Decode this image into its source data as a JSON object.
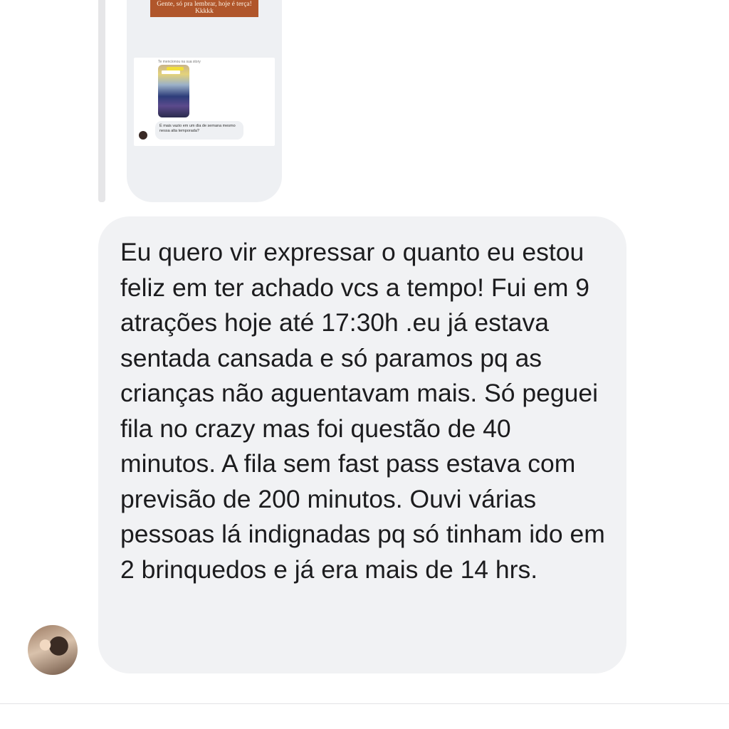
{
  "story_reply": {
    "banner_text": "Gente, só pra lembrar, hoje é terça! Kkkkk",
    "shot_caption": "Te mencionou na sua story",
    "shot_reply_text": "É mais vazio em um dia de semana mesmo nessa alta temporada?"
  },
  "message": {
    "segments": [
      "Eu quero",
      " vir expressar o quanto eu",
      " estou fe",
      "liz em ter achado vcs a tempo! Fui em ",
      "9 atrações hoje",
      "  até 17:30h .eu já estava sentada cansada e só paramos pq as crianças não aguentavam mais.  Só peguei fila no crazy mas foi questão de 40 minutos. A fila sem fast pass estava com previsão de 200 minutos. Ouvi várias pessoas lá indignadas pq só tinham ido em 2 brinquedos e já era mais de 14 hrs."
    ]
  },
  "colors": {
    "bubble": "#f1f2f4",
    "highlight": "#f6f07e",
    "text": "#1c1c1e"
  }
}
